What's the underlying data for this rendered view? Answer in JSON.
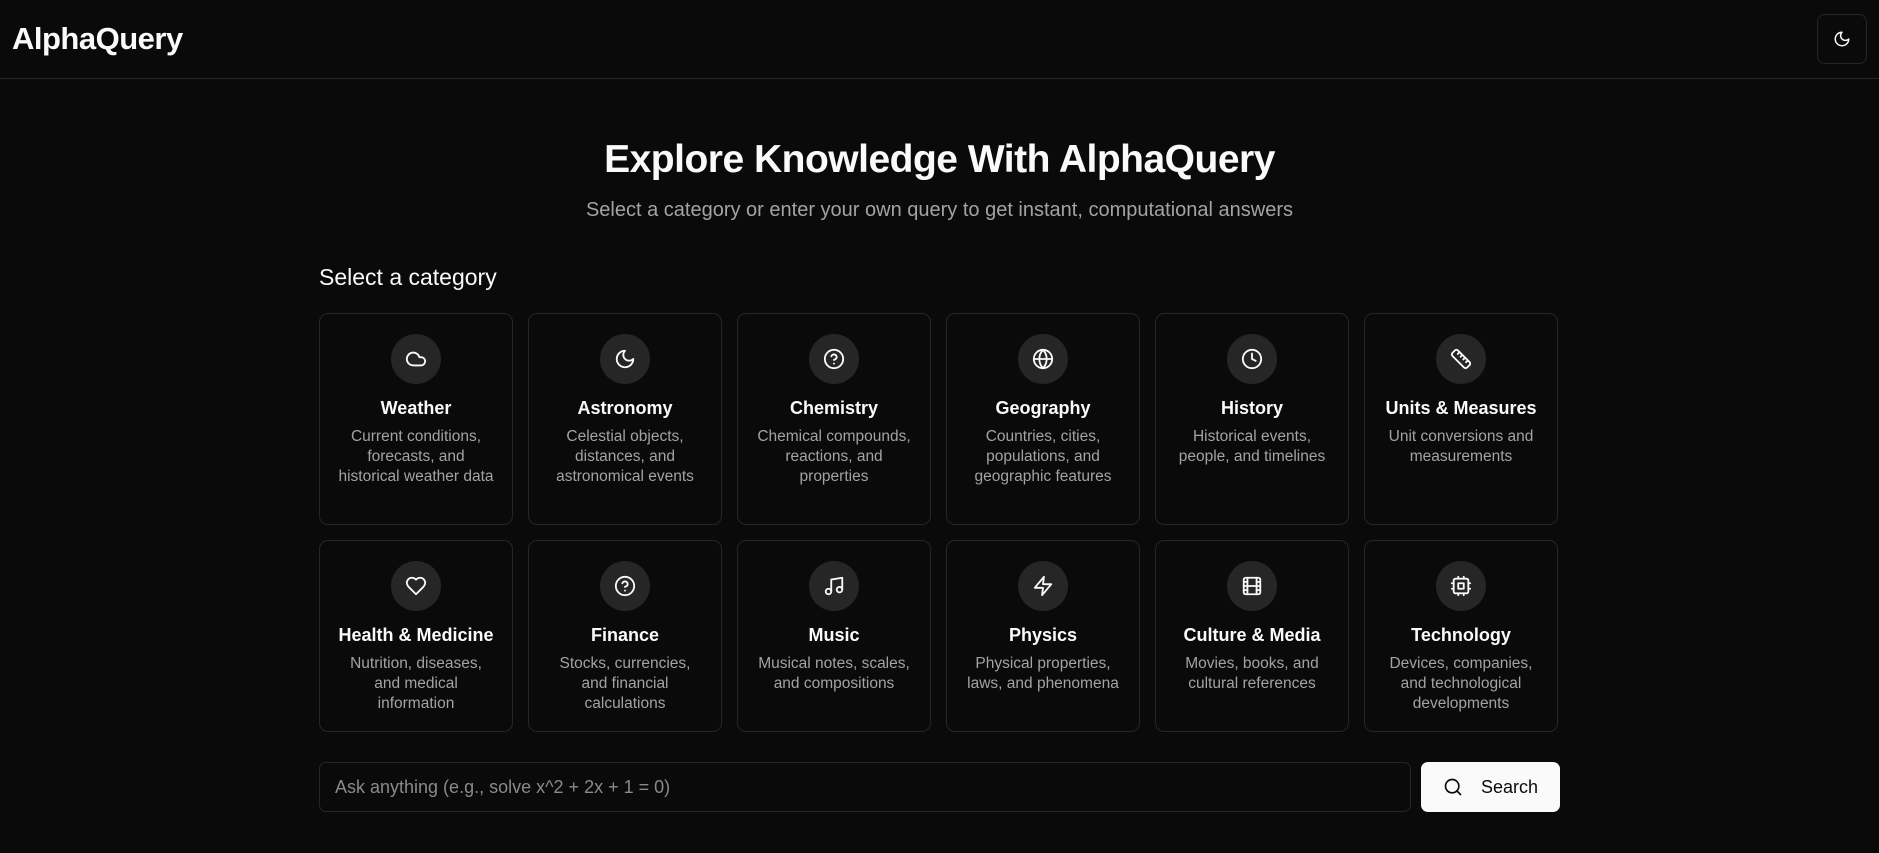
{
  "header": {
    "brand": "AlphaQuery",
    "theme_toggle_icon": "moon-icon"
  },
  "hero": {
    "title": "Explore Knowledge With AlphaQuery",
    "subtitle": "Select a category or enter your own query to get instant, computational answers"
  },
  "categories_heading": "Select a category",
  "categories": [
    {
      "title": "Weather",
      "desc": "Current conditions, forecasts, and historical weather data",
      "icon": "cloud-icon"
    },
    {
      "title": "Astronomy",
      "desc": "Celestial objects, distances, and astronomical events",
      "icon": "moon-icon"
    },
    {
      "title": "Chemistry",
      "desc": "Chemical compounds, reactions, and properties",
      "icon": "help-circle-icon"
    },
    {
      "title": "Geography",
      "desc": "Countries, cities, populations, and geographic features",
      "icon": "globe-icon"
    },
    {
      "title": "History",
      "desc": "Historical events, people, and timelines",
      "icon": "clock-icon"
    },
    {
      "title": "Units & Measures",
      "desc": "Unit conversions and measurements",
      "icon": "ruler-icon"
    },
    {
      "title": "Health & Medicine",
      "desc": "Nutrition, diseases, and medical information",
      "icon": "heart-icon"
    },
    {
      "title": "Finance",
      "desc": "Stocks, currencies, and financial calculations",
      "icon": "help-circle-icon"
    },
    {
      "title": "Music",
      "desc": "Musical notes, scales, and compositions",
      "icon": "music-icon"
    },
    {
      "title": "Physics",
      "desc": "Physical properties, laws, and phenomena",
      "icon": "zap-icon"
    },
    {
      "title": "Culture & Media",
      "desc": "Movies, books, and cultural references",
      "icon": "film-icon"
    },
    {
      "title": "Technology",
      "desc": "Devices, companies, and technological developments",
      "icon": "cpu-icon"
    }
  ],
  "search": {
    "placeholder": "Ask anything (e.g., solve x^2 + 2x + 1 = 0)",
    "value": "",
    "button_label": "Search"
  },
  "colors": {
    "background": "#0a0a0a",
    "card_border": "#262626",
    "muted_text": "#a3a3a3",
    "button_bg": "#fafafa"
  }
}
